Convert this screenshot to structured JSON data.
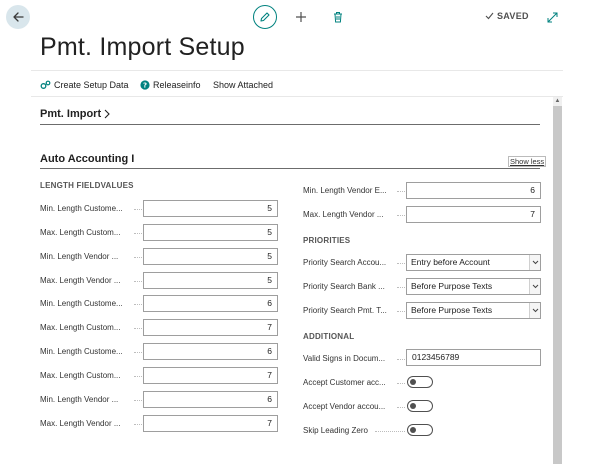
{
  "header": {
    "title": "Pmt. Import Setup",
    "saved_label": "SAVED"
  },
  "icons": {
    "back": "arrow-left-icon",
    "edit": "pencil-icon",
    "new": "plus-icon",
    "delete": "trash-icon",
    "saved": "check-icon",
    "expand": "expand-arrows-icon"
  },
  "actions": {
    "create_setup_data": "Create Setup Data",
    "releaseinfo": "Releaseinfo",
    "show_attached": "Show Attached"
  },
  "sections": {
    "pmt_import": "Pmt. Import",
    "auto_accounting": "Auto Accounting I",
    "show_less": "Show less"
  },
  "left_group": {
    "heading": "LENGTH FIELDVALUES",
    "fields": [
      {
        "label": "Min. Length Custome...",
        "value": "5"
      },
      {
        "label": "Max. Length Custom...",
        "value": "5"
      },
      {
        "label": "Min. Length Vendor ...",
        "value": "5"
      },
      {
        "label": "Max. Length Vendor ...",
        "value": "5"
      },
      {
        "label": "Min. Length Custome...",
        "value": "6"
      },
      {
        "label": "Max. Length Custom...",
        "value": "7"
      },
      {
        "label": "Min. Length Custome...",
        "value": "6"
      },
      {
        "label": "Max. Length Custom...",
        "value": "7"
      },
      {
        "label": "Min. Length Vendor ...",
        "value": "6"
      },
      {
        "label": "Max. Length Vendor ...",
        "value": "7"
      }
    ]
  },
  "right_top": {
    "fields": [
      {
        "label": "Min. Length Vendor E...",
        "value": "6"
      },
      {
        "label": "Max. Length Vendor ...",
        "value": "7"
      }
    ]
  },
  "priorities": {
    "heading": "PRIORITIES",
    "fields": [
      {
        "label": "Priority Search Accou...",
        "value": "Entry before Account"
      },
      {
        "label": "Priority Search Bank ...",
        "value": "Before Purpose Texts"
      },
      {
        "label": "Priority Search Pmt. T...",
        "value": "Before Purpose Texts"
      }
    ]
  },
  "additional": {
    "heading": "ADDITIONAL",
    "valid_signs_label": "Valid Signs in Docum...",
    "valid_signs_value": "0123456789",
    "toggles": [
      {
        "label": "Accept Customer acc...",
        "on": false
      },
      {
        "label": "Accept Vendor accou...",
        "on": false
      },
      {
        "label": "Skip Leading Zero",
        "on": false
      }
    ]
  },
  "colors": {
    "accent": "#00827f",
    "back_button_bg": "#d9e6ec",
    "border": "#9e9e9e"
  }
}
